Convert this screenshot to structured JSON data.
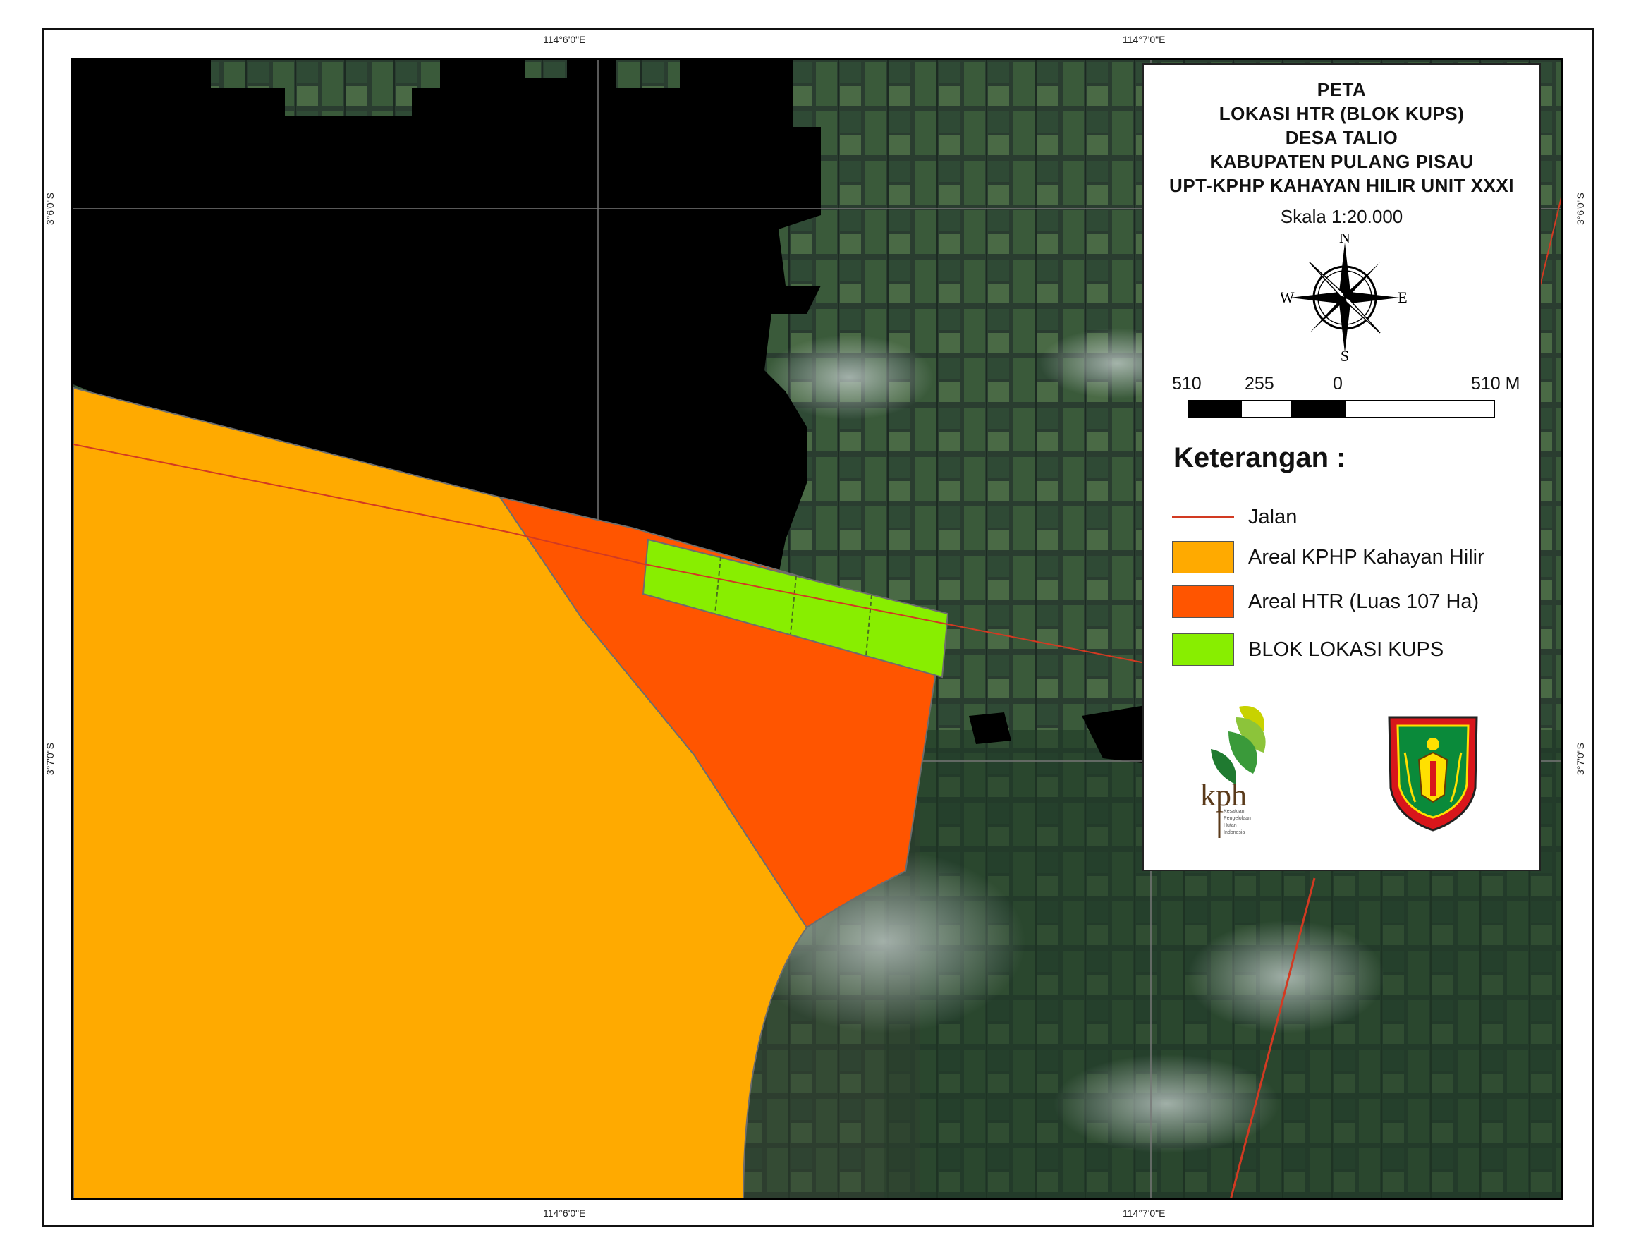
{
  "map": {
    "title_lines": [
      "PETA",
      "LOKASI HTR (BLOK KUPS)",
      "DESA TALIO",
      "KABUPATEN PULANG PISAU",
      "UPT-KPHP KAHAYAN HILIR UNIT XXXI"
    ],
    "scale_text": "Skala 1:20.000",
    "compass": {
      "n": "N",
      "s": "S",
      "e": "E",
      "w": "W"
    },
    "scalebar_labels": [
      "510",
      "255",
      "0",
      "510 M"
    ],
    "legend_heading": "Keterangan :",
    "legend": [
      {
        "label": "Jalan",
        "symbol": "line",
        "color": "#d23a22"
      },
      {
        "label": "Areal KPHP Kahayan Hilir",
        "symbol": "fill",
        "color": "#ffaa00"
      },
      {
        "label": "Areal HTR (Luas 107 Ha)",
        "symbol": "fill",
        "color": "#ff5500"
      },
      {
        "label": "BLOK LOKASI KUPS",
        "symbol": "fill",
        "color": "#88ee00"
      }
    ],
    "coordinates": {
      "top_left": "114°6'0\"E",
      "top_right": "114°7'0\"E",
      "bottom_left": "114°6'0\"E",
      "bottom_right": "114°7'0\"E",
      "left_upper": "3°6'0\"S",
      "left_lower": "3°7'0\"S",
      "right_upper": "3°6'0\"S",
      "right_lower": "3°7'0\"S"
    },
    "logos": {
      "kph_text": "kph",
      "kph_subtext": [
        "Kesatuan",
        "Pengelolaan",
        "Hutan",
        "Indonesia"
      ]
    }
  }
}
